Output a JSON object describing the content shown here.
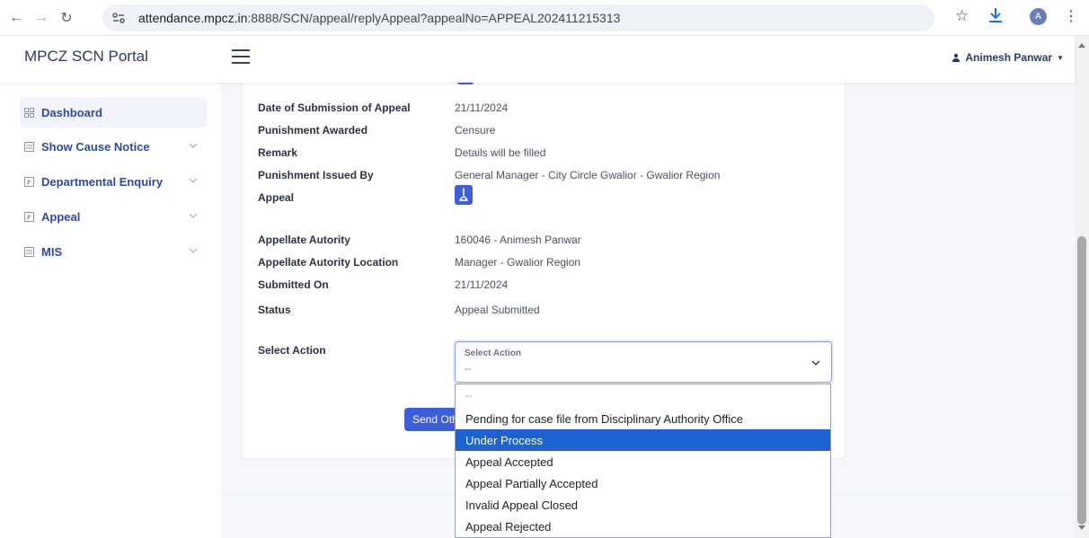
{
  "browser": {
    "url_host": "attendance.mpcz.in",
    "url_rest": ":8888/SCN/appeal/replyAppeal?appealNo=APPEAL202411215313",
    "profile_initial": "A"
  },
  "header": {
    "brand": "MPCZ SCN Portal",
    "user_name": "Animesh Panwar"
  },
  "sidebar": {
    "items": [
      {
        "label": "Dashboard",
        "icon": "grid-icon"
      },
      {
        "label": "Show Cause Notice",
        "icon": "list-icon"
      },
      {
        "label": "Departmental Enquiry",
        "icon": "file-icon"
      },
      {
        "label": "Appeal",
        "icon": "file-icon"
      },
      {
        "label": "MIS",
        "icon": "list-icon"
      }
    ]
  },
  "details": {
    "date_submission_label": "Date of Submission of Appeal",
    "date_submission_value": "21/11/2024",
    "punishment_awarded_label": "Punishment Awarded",
    "punishment_awarded_value": "Censure",
    "remark_label": "Remark",
    "remark_value": "Details will be filled",
    "punishment_issued_label": "Punishment Issued By",
    "punishment_issued_value": "General Manager - City Circle Gwalior - Gwalior Region",
    "appeal_label": "Appeal",
    "appellate_authority_label": "Appellate Autority",
    "appellate_authority_value": "160046 - Animesh Panwar",
    "appellate_location_label": "Appellate Autority Location",
    "appellate_location_value": "Manager - Gwalior Region",
    "submitted_on_label": "Submitted On",
    "submitted_on_value": "21/11/2024",
    "status_label": "Status",
    "status_value": "Appeal Submitted",
    "select_action_label": "Select Action"
  },
  "select": {
    "floating_label": "Select Action",
    "value": "--"
  },
  "send_button_label": "Send Other",
  "dropdown_options": [
    "--",
    "Pending for case file from Disciplinary Authority Office",
    "Under Process",
    "Appeal Accepted",
    "Appeal Partially Accepted",
    "Invalid Appeal Closed",
    "Appeal Rejected"
  ],
  "selected_option": "Under Process",
  "colors": {
    "accent": "#3d5ed8",
    "highlight": "#1a63d0",
    "brand_text": "#2b3a63"
  }
}
